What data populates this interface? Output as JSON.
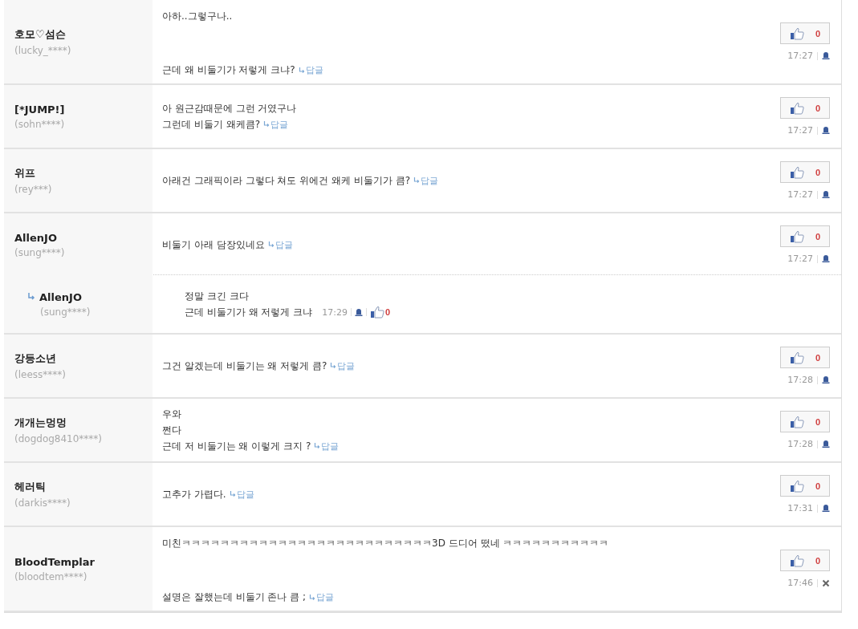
{
  "comments": [
    {
      "name": "호모♡섬슨",
      "user_id": "(lucky_****)",
      "kind": "spread",
      "lines": [
        "아하..그렇구나..",
        "근데 왜 비둘기가 저렇게 크냐?"
      ],
      "reply_link": "답글",
      "likes": "0",
      "time": "17:27",
      "deletable": false
    },
    {
      "name": "[*JUMP!]",
      "user_id": "(sohn****)",
      "kind": "plain",
      "lines": [
        "아 원근감때문에 그런 거였구나",
        "그런데 비둘기 왜케큼?"
      ],
      "reply_link": "답글",
      "likes": "0",
      "time": "17:27",
      "deletable": false
    },
    {
      "name": "위프",
      "user_id": "(rey***)",
      "kind": "plain",
      "lines": [
        "아래건 그래픽이라 그렇다 쳐도 위에건 왜케 비둘기가 큼?"
      ],
      "reply_link": "답글",
      "likes": "0",
      "time": "17:27",
      "deletable": false
    },
    {
      "name": "AllenJO",
      "user_id": "(sung****)",
      "kind": "plain",
      "lines": [
        "비둘기 아래 담장있네요"
      ],
      "reply_link": "답글",
      "likes": "0",
      "time": "17:27",
      "deletable": false,
      "replies": [
        {
          "name": "AllenJO",
          "user_id": "(sung****)",
          "lines": [
            "정말 크긴 크다",
            "근데 비둘기가 왜 저렇게 크냐"
          ],
          "time": "17:29",
          "likes": "0"
        }
      ]
    },
    {
      "name": "강등소년",
      "user_id": "(leess****)",
      "kind": "plain",
      "lines": [
        "그건 알겠는데 비둘기는 왜 저렇게 큼?"
      ],
      "reply_link": "답글",
      "likes": "0",
      "time": "17:28",
      "deletable": false
    },
    {
      "name": "개개는멍멍",
      "user_id": "(dogdog8410****)",
      "kind": "plain",
      "lines": [
        "우와",
        "쩐다",
        "근데 저 비둘기는 왜 이렇게 크지 ?"
      ],
      "reply_link": "답글",
      "likes": "0",
      "time": "17:28",
      "deletable": false
    },
    {
      "name": "헤러틱",
      "user_id": "(darkis****)",
      "kind": "plain",
      "lines": [
        "고추가 가렵다."
      ],
      "reply_link": "답글",
      "likes": "0",
      "time": "17:31",
      "deletable": false
    },
    {
      "name": "BloodTemplar",
      "user_id": "(bloodtem****)",
      "kind": "spread",
      "lines": [
        "미친ㅋㅋㅋㅋㅋㅋㅋㅋㅋㅋㅋㅋㅋㅋㅋㅋㅋㅋㅋㅋㅋㅋㅋㅋㅋㅋ3D 드디어 떴네 ㅋㅋㅋㅋㅋㅋㅋㅋㅋㅋㅋ",
        "설명은 잘했는데 비둘기 존나 큼 ;"
      ],
      "reply_link": "답글",
      "likes": "0",
      "time": "17:46",
      "deletable": true
    }
  ]
}
